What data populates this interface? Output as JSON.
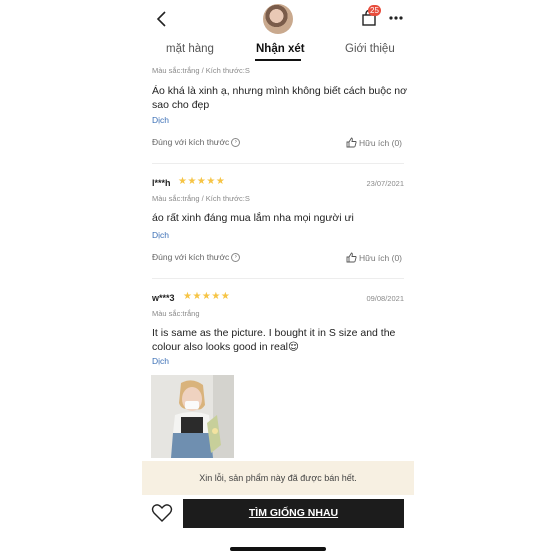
{
  "header": {
    "cart_count": "25",
    "icons": [
      "back-chevron-icon",
      "shop-avatar",
      "shopping-bag-icon",
      "more-dots-icon"
    ]
  },
  "tabs": [
    {
      "label": "mặt hàng"
    },
    {
      "label": "Nhận xét",
      "active": true
    },
    {
      "label": "Giới thiệu"
    }
  ],
  "reviews": [
    {
      "variant": "Màu sắc:trắng / Kích thước:S",
      "text": "Áo khá là xinh ạ, nhưng mình không biết cách buộc nơ sao cho đẹp",
      "translate": "Dịch",
      "fit": "Đúng với kích thước",
      "helpful": "Hữu ích (0)"
    },
    {
      "user": "l***h",
      "rating": 5,
      "stars": "★★★★★",
      "date": "23/07/2021",
      "variant": "Màu sắc:trắng / Kích thước:S",
      "text": "áo rất xinh đáng mua lắm nha mọi người ưi",
      "translate": "Dịch",
      "fit": "Đúng với kích thước",
      "helpful": "Hữu ích (0)"
    },
    {
      "user": "w***3",
      "rating": 5,
      "stars": "★★★★★",
      "date": "09/08/2021",
      "variant": "Màu sắc:trắng",
      "text": "It is same as the picture. I bought it in S size and the colour also looks good in real😌",
      "translate": "Dịch"
    }
  ],
  "notice": "Xin lỗi, sản phẩm này đã được bán hết.",
  "footer": {
    "cta_label": "TÌM GIỐNG NHAU"
  },
  "colors": {
    "star": "#f6c445",
    "translate_link": "#3b6fb6",
    "notice_bg": "#f7f0e2",
    "cta_bg": "#1c1c1c",
    "badge": "#e74c3c"
  }
}
